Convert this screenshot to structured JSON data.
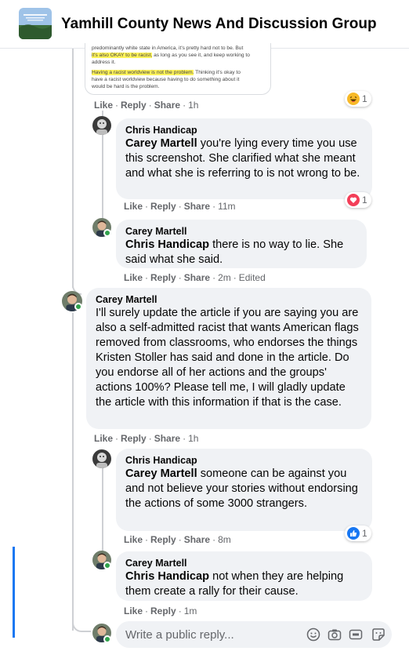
{
  "group": {
    "title": "Yamhill County News And Discussion Group"
  },
  "screenshot": {
    "lines": [
      {
        "text": "predominantly white state in America, it's pretty hard not to be.  But",
        "highlight": ""
      },
      {
        "text": " as long as you see it, and keep working to",
        "highlight": "it's also OKAY to be racist,"
      },
      {
        "text": "address it.",
        "highlight": ""
      },
      {
        "text": "",
        "highlight": ""
      },
      {
        "text": " Thinking it's okay to",
        "highlight": "Having a racist worldview is not the problem."
      },
      {
        "text": "have a racist worldview because having to do something about it",
        "highlight": ""
      },
      {
        "text": "would be hard is the problem.",
        "highlight": ""
      }
    ]
  },
  "labels": {
    "like": "Like",
    "reply": "Reply",
    "share": "Share",
    "dot": "·"
  },
  "comments": [
    {
      "id": "c0",
      "actions_only": true,
      "time": "1h",
      "reaction": {
        "type": "haha",
        "count": "1"
      }
    },
    {
      "id": "c1",
      "author": "Chris Handicap",
      "mention": "Carey Martell",
      "text": " you're lying every time you use this screenshot. She clarified what she meant and what she is referring to is not wrong to be.",
      "time": "11m",
      "edited": "",
      "reaction": {
        "type": "love",
        "count": "1"
      }
    },
    {
      "id": "c2",
      "author": "Carey Martell",
      "mention": "Chris Handicap",
      "text": " there is no way to lie. She said what she said.",
      "time": "2m",
      "edited": "Edited"
    },
    {
      "id": "c3",
      "author": "Carey Martell",
      "mention": "",
      "text": "I'll surely update the article if you are saying you are also a self-admitted racist that wants American flags removed from classrooms, who endorses the things Kristen Stoller has said and done in the article. Do you endorse all of her actions and the groups' actions 100%? Please tell me, I will gladly update the article with this information if that is the case.",
      "time": "1h",
      "edited": ""
    },
    {
      "id": "c4",
      "author": "Chris Handicap",
      "mention": "Carey Martell",
      "text": " someone can be against you and not believe your stories without endorsing the actions of some 3000 strangers.",
      "time": "8m",
      "edited": "",
      "reaction": {
        "type": "like",
        "count": "1"
      }
    },
    {
      "id": "c5",
      "author": "Carey Martell",
      "mention": "Chris Handicap",
      "text": " not when they are helping them create a rally for their cause.",
      "time": "1m",
      "edited": ""
    }
  ],
  "reply_box": {
    "placeholder": "Write a public reply..."
  },
  "colors": {
    "accent": "#1877f2",
    "online": "#31a24c",
    "bubble": "#f0f2f5",
    "love": "#f33e58",
    "haha": "#f7b928"
  }
}
